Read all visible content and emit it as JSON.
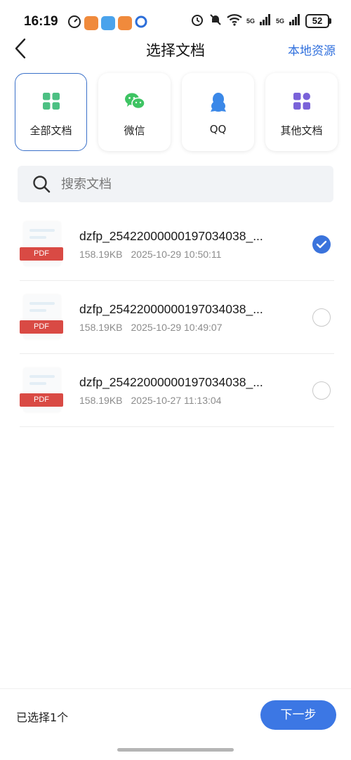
{
  "status_bar": {
    "time": "16:19",
    "battery": "52",
    "network_labels": [
      "5G",
      "5G"
    ],
    "icons": [
      "speed-icon",
      "app-notification-icon",
      "weather-icon",
      "app-notification-icon",
      "browser-icon",
      "alarm-icon",
      "mute-icon",
      "wifi-icon",
      "signal-icon",
      "signal-icon",
      "battery-icon"
    ]
  },
  "header": {
    "title": "选择文档",
    "local_resources": "本地资源",
    "back_icon": "chevron-left-icon"
  },
  "categories": [
    {
      "label": "全部文档",
      "icon": "grid-icon",
      "color": "#4cc083",
      "active": true
    },
    {
      "label": "微信",
      "icon": "wechat-icon",
      "color": "#3ec463",
      "active": false
    },
    {
      "label": "QQ",
      "icon": "penguin-icon",
      "color": "#3b88e8",
      "active": false
    },
    {
      "label": "其他文档",
      "icon": "grid-icon",
      "color": "#7a62d9",
      "active": false
    }
  ],
  "search": {
    "placeholder": "搜索文档",
    "value": ""
  },
  "files": [
    {
      "name": "dzfp_25422000000197034038_...",
      "size": "158.19KB",
      "date": "2025-10-29 10:50:11",
      "badge": "PDF",
      "selected": true
    },
    {
      "name": "dzfp_25422000000197034038_...",
      "size": "158.19KB",
      "date": "2025-10-29 10:49:07",
      "badge": "PDF",
      "selected": false
    },
    {
      "name": "dzfp_25422000000197034038_...",
      "size": "158.19KB",
      "date": "2025-10-27 11:13:04",
      "badge": "PDF",
      "selected": false
    }
  ],
  "bottom": {
    "selected_text": "已选择1个",
    "next_label": "下一步"
  },
  "colors": {
    "accent": "#3c77e4",
    "pdf_badge": "#d94a44"
  }
}
